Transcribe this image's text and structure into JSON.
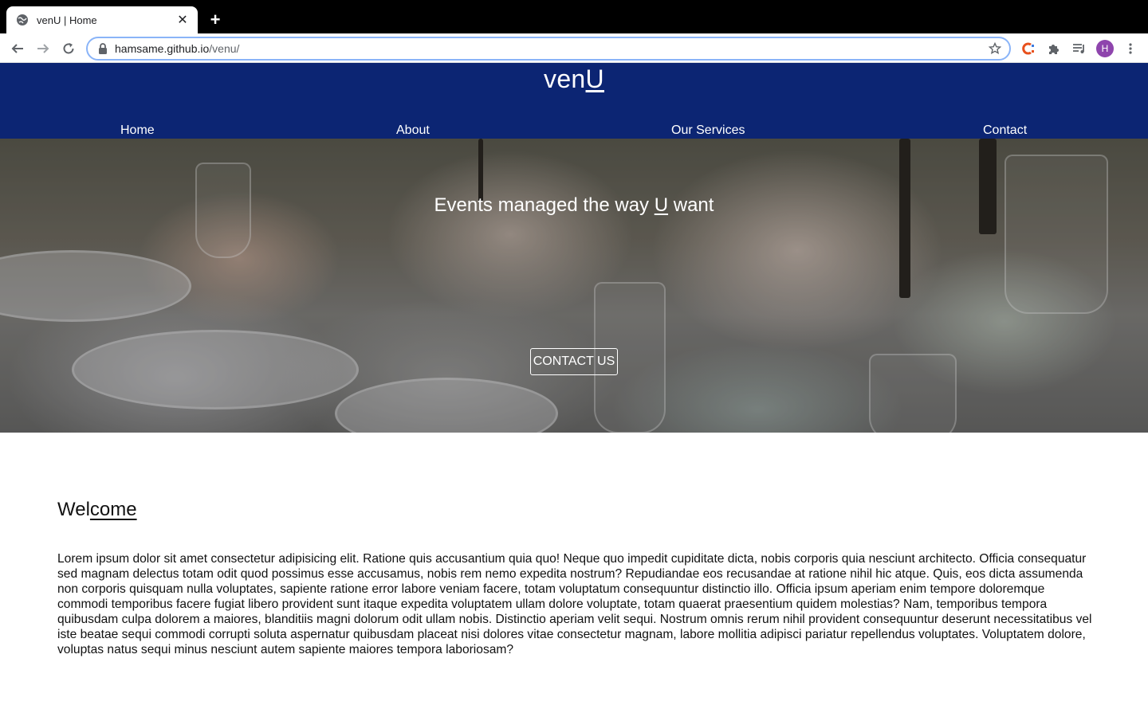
{
  "browser": {
    "tab_title": "venU | Home",
    "url_host": "hamsame.github.io",
    "url_path": "/venu/",
    "avatar_letter": "H",
    "icons": [
      "globe-icon",
      "close-icon",
      "plus-icon",
      "back-icon",
      "forward-icon",
      "reload-icon",
      "lock-icon",
      "star-icon",
      "extension-c-icon",
      "puzzle-icon",
      "media-icon",
      "more-icon"
    ]
  },
  "site": {
    "logo_prefix": "ven",
    "logo_highlight": "U",
    "nav": {
      "home": "Home",
      "about": "About",
      "services": "Our Services",
      "contact": "Contact"
    },
    "colors": {
      "header_bg": "#0c2573",
      "text": "#ffffff"
    }
  },
  "hero": {
    "tagline_before": "Events managed the way ",
    "tagline_highlight": "U",
    "tagline_after": " want",
    "button_label": "CONTACT US"
  },
  "welcome": {
    "title_start": "Wel",
    "title_underlined": "come",
    "body": "Lorem ipsum dolor sit amet consectetur adipisicing elit. Ratione quis accusantium quia quo! Neque quo impedit cupiditate dicta, nobis corporis quia nesciunt architecto. Officia consequatur sed magnam delectus totam odit quod possimus esse accusamus, nobis rem nemo expedita nostrum? Repudiandae eos recusandae at ratione nihil hic atque. Quis, eos dicta assumenda non corporis quisquam nulla voluptates, sapiente ratione error labore veniam facere, totam voluptatum consequuntur distinctio illo. Officia ipsum aperiam enim tempore doloremque commodi temporibus facere fugiat libero provident sunt itaque expedita voluptatem ullam dolore voluptate, totam quaerat praesentium quidem molestias? Nam, temporibus tempora quibusdam culpa dolorem a maiores, blanditiis magni dolorum odit ullam nobis. Distinctio aperiam velit sequi. Nostrum omnis rerum nihil provident consequuntur deserunt necessitatibus vel iste beatae sequi commodi corrupti soluta aspernatur quibusdam placeat nisi dolores vitae consectetur magnam, labore mollitia adipisci pariatur repellendus voluptates. Voluptatem dolore, voluptas natus sequi minus nesciunt autem sapiente maiores tempora laboriosam?"
  }
}
